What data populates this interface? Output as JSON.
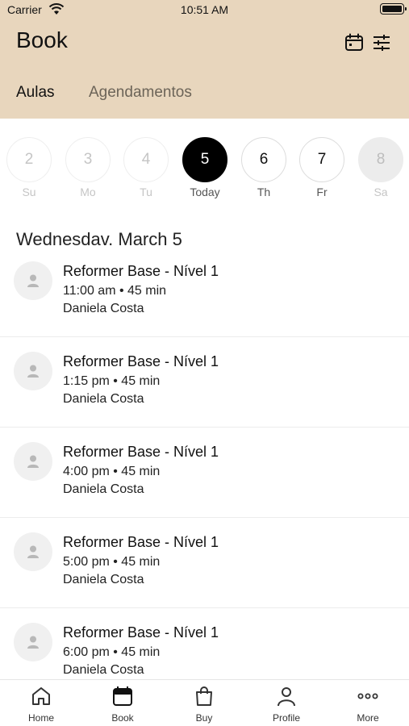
{
  "status_bar": {
    "carrier": "Carrier",
    "time": "10:51 AM"
  },
  "header": {
    "title": "Book"
  },
  "tabs": [
    {
      "label": "Aulas",
      "active": true
    },
    {
      "label": "Agendamentos",
      "active": false
    }
  ],
  "days": [
    {
      "number": "2",
      "name": "Su",
      "state": "past"
    },
    {
      "number": "3",
      "name": "Mo",
      "state": "past"
    },
    {
      "number": "4",
      "name": "Tu",
      "state": "past"
    },
    {
      "number": "5",
      "name": "Today",
      "state": "selected"
    },
    {
      "number": "6",
      "name": "Th",
      "state": "available"
    },
    {
      "number": "7",
      "name": "Fr",
      "state": "available"
    },
    {
      "number": "8",
      "name": "Sa",
      "state": "disabled"
    }
  ],
  "date_heading": "Wednesdav. March 5",
  "classes": [
    {
      "name": "Reformer Base - Nível 1",
      "time": "11:00 am • 45 min",
      "instructor": "Daniela Costa"
    },
    {
      "name": "Reformer Base - Nível 1",
      "time": "1:15 pm • 45 min",
      "instructor": "Daniela Costa"
    },
    {
      "name": "Reformer Base - Nível 1",
      "time": "4:00 pm • 45 min",
      "instructor": "Daniela Costa"
    },
    {
      "name": "Reformer Base - Nível 1",
      "time": "5:00 pm • 45 min",
      "instructor": "Daniela Costa"
    },
    {
      "name": "Reformer Base - Nível 1",
      "time": "6:00 pm • 45 min",
      "instructor": "Daniela Costa"
    }
  ],
  "tabbar": [
    {
      "label": "Home",
      "icon": "home-icon"
    },
    {
      "label": "Book",
      "icon": "calendar-icon"
    },
    {
      "label": "Buy",
      "icon": "shopping-bag-icon"
    },
    {
      "label": "Profile",
      "icon": "person-icon"
    },
    {
      "label": "More",
      "icon": "more-dots-icon"
    }
  ],
  "colors": {
    "header_bg": "#e8d6bd",
    "selected_day": "#000000"
  }
}
